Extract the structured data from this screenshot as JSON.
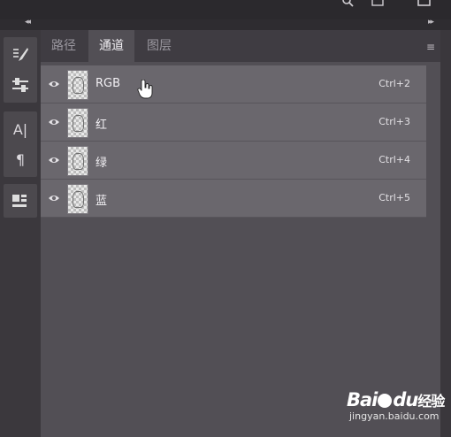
{
  "topbar": {
    "search_icon": "search-icon",
    "icons": [
      "document-icon",
      "window-icon"
    ]
  },
  "collapse": {
    "left": "◂◂",
    "right": "▸▸"
  },
  "toolbar": {
    "tools": [
      "brush-settings-icon",
      "adjustments-icon",
      "character-icon",
      "paragraph-icon",
      "properties-icon"
    ],
    "character_glyph": "A|",
    "paragraph_glyph": "¶"
  },
  "panel": {
    "tabs": [
      {
        "label": "路径",
        "active": false
      },
      {
        "label": "通道",
        "active": true
      },
      {
        "label": "图层",
        "active": false
      }
    ],
    "menu_icon": "≡",
    "channels": [
      {
        "name": "RGB",
        "shortcut": "Ctrl+2"
      },
      {
        "name": "红",
        "shortcut": "Ctrl+3"
      },
      {
        "name": "绿",
        "shortcut": "Ctrl+4"
      },
      {
        "name": "蓝",
        "shortcut": "Ctrl+5"
      }
    ]
  },
  "watermark": {
    "logo_left": "Bai",
    "logo_mid": "du",
    "logo_cn": "经验",
    "url": "jingyan.baidu.com"
  }
}
